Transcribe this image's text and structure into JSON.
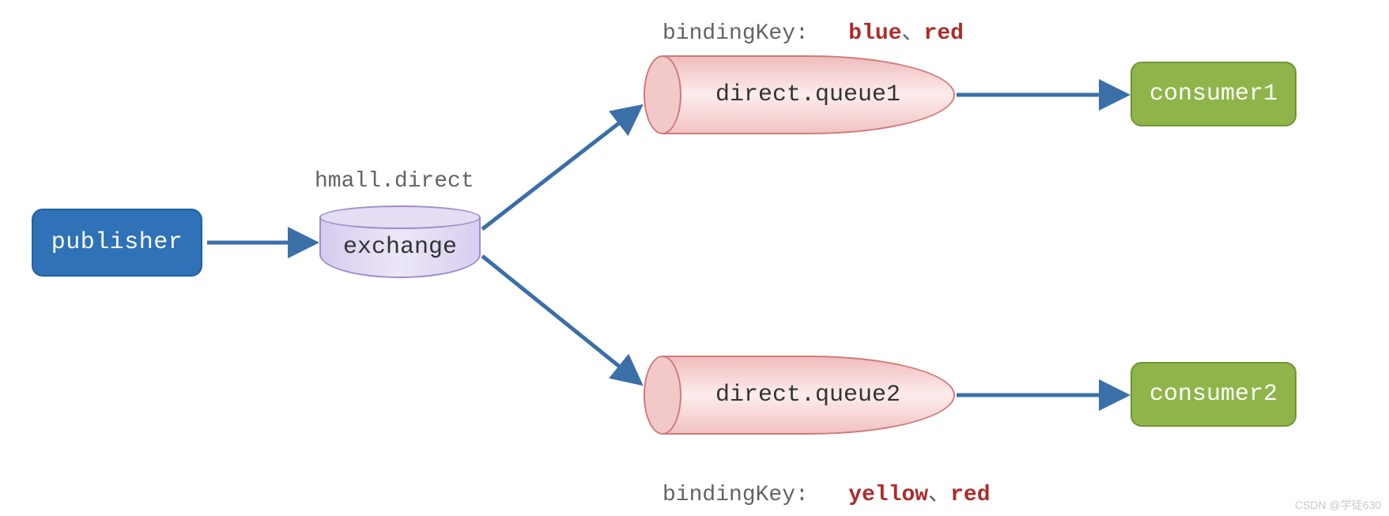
{
  "publisher": {
    "label": "publisher"
  },
  "exchange": {
    "name": "hmall.direct",
    "label": "exchange"
  },
  "queues": {
    "q1": {
      "label": "direct.queue1",
      "bindingKeyPrefix": "bindingKey:",
      "bindingKeys": [
        "blue",
        "red"
      ],
      "separator": "、"
    },
    "q2": {
      "label": "direct.queue2",
      "bindingKeyPrefix": "bindingKey:",
      "bindingKeys": [
        "yellow",
        "red"
      ],
      "separator": "、"
    }
  },
  "consumers": {
    "c1": {
      "label": "consumer1"
    },
    "c2": {
      "label": "consumer2"
    }
  },
  "watermark": "CSDN @学徒630",
  "colors": {
    "arrow": "#3b6fa8",
    "publisherFill": "#2f72b7",
    "exchangeFill": "#e4ddf4",
    "queueFill": "#f3c8c8",
    "consumerFill": "#8fb54a",
    "bindingKeyValue": "#b02a2a",
    "labelGrey": "#636363"
  }
}
